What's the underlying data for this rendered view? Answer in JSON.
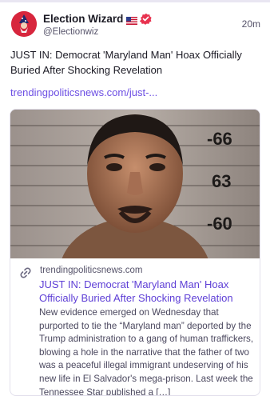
{
  "post": {
    "author_name": "Election Wizard",
    "author_handle": "@Electionwiz",
    "timestamp": "20m",
    "flag_emoji": "us-flag-icon",
    "text": "JUST IN: Democrat 'Maryland Man' Hoax Officially Buried After Shocking Revelation",
    "link_text": "trendingpoliticsnews.com/just-..."
  },
  "card": {
    "image_desc": "mugshot",
    "height_scale": [
      "-66",
      "63",
      "-60"
    ],
    "domain": "trendingpoliticsnews.com",
    "title": "JUST IN: Democrat 'Maryland Man' Hoax Officially Buried After Shocking Revelation",
    "description": "New evidence emerged on Wednesday that purported to tie the “Maryland man” deported by the Trump administration to a gang of human traffickers, blowing a hole in the narrative that the father of two was a peaceful illegal immigrant undeserving of his new life in El Salvador's mega-prison. Last week the Tennessee Star published a […]"
  },
  "colors": {
    "accent": "#6c4ee3",
    "avatar_bg": "#d7263d",
    "verified": "#e8324f"
  }
}
